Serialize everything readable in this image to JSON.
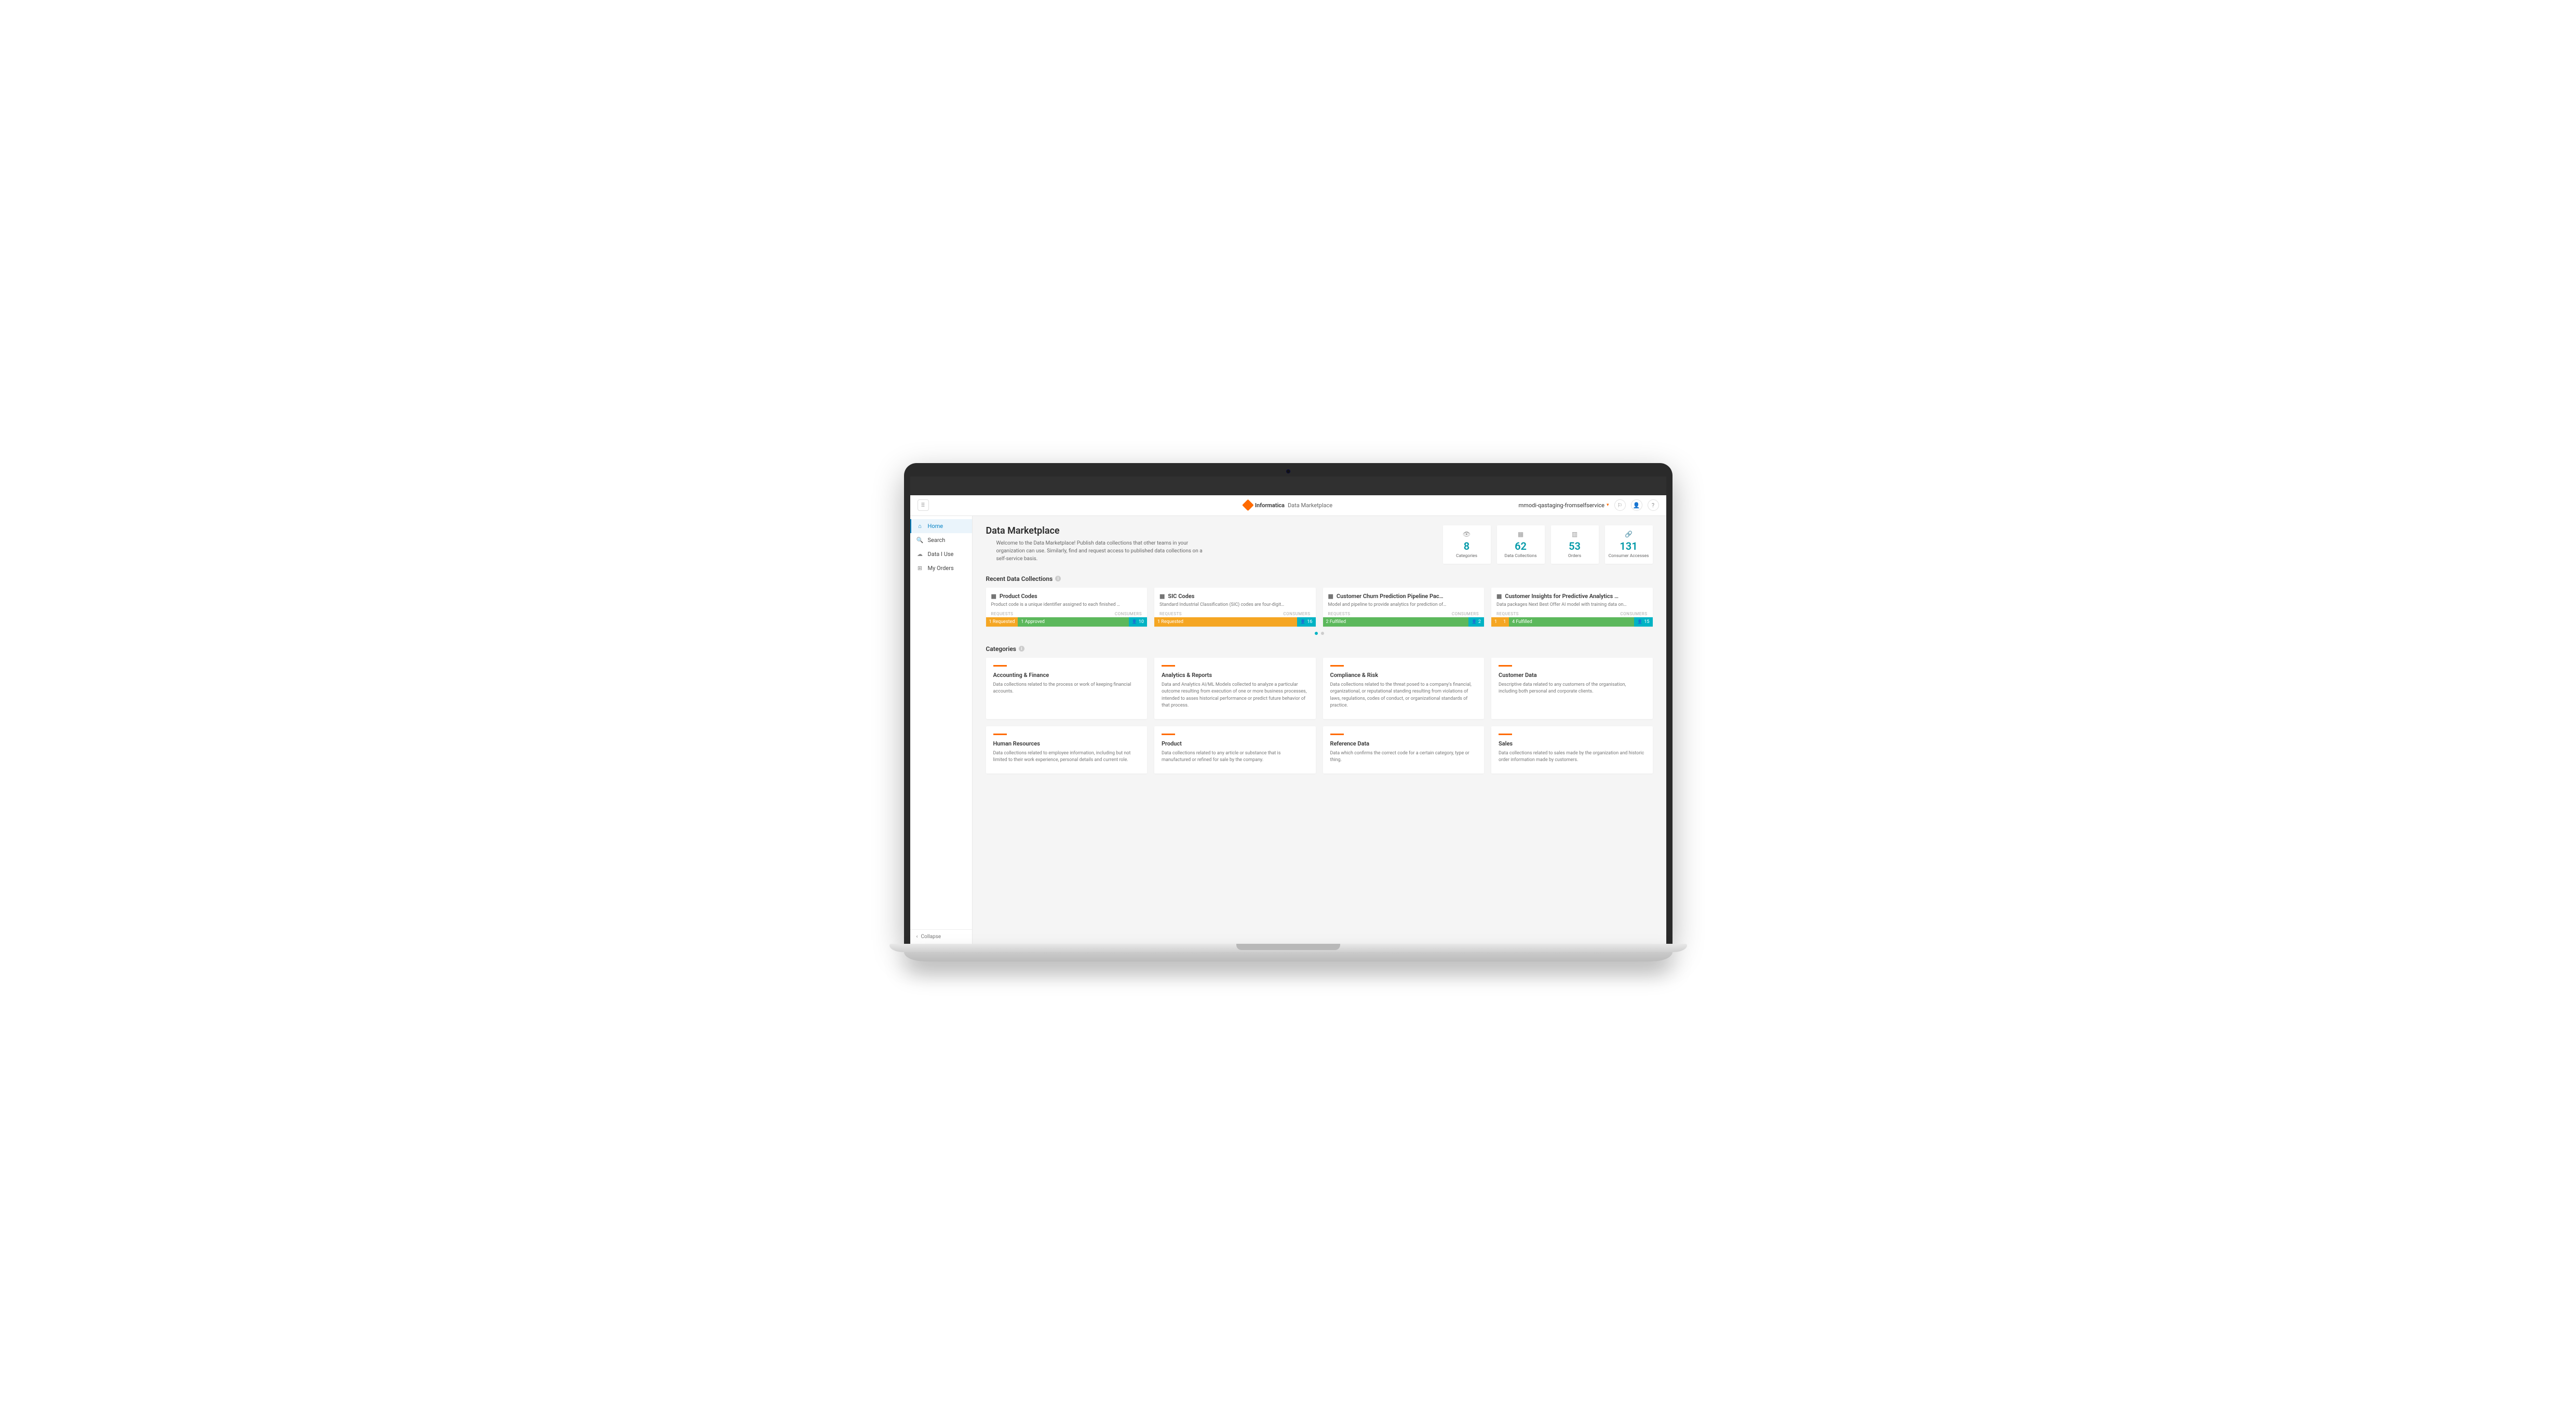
{
  "header": {
    "brand_name": "Informatica",
    "brand_sub": "Data Marketplace",
    "org": "mmodi-qastaging-fromselfservice",
    "icons": {
      "notif": "⚐",
      "user": "👤",
      "help": "?"
    }
  },
  "sidebar": {
    "items": [
      {
        "icon": "⌂",
        "label": "Home"
      },
      {
        "icon": "🔍",
        "label": "Search"
      },
      {
        "icon": "☁",
        "label": "Data I Use"
      },
      {
        "icon": "⊞",
        "label": "My Orders"
      }
    ],
    "collapse": "Collapse"
  },
  "page": {
    "title": "Data Marketplace",
    "desc": "Welcome to the Data Marketplace! Publish data collections that other teams in your organization can use. Similarly, find and request access to published data collections on a self-service basis."
  },
  "stats": [
    {
      "icon": "👁",
      "value": "8",
      "label": "Categories"
    },
    {
      "icon": "▦",
      "value": "62",
      "label": "Data Collections"
    },
    {
      "icon": "▥",
      "value": "53",
      "label": "Orders"
    },
    {
      "icon": "🔗",
      "value": "131",
      "label": "Consumer Accesses"
    }
  ],
  "sections": {
    "recent": "Recent Data Collections",
    "categories": "Categories",
    "requests": "REQUESTS",
    "consumers": "CONSUMERS"
  },
  "recent": [
    {
      "title": "Product Codes",
      "desc": "Product code is a unique identifier assigned to each finished …",
      "segs": [
        {
          "cls": "orange",
          "text": "1 Requested"
        },
        {
          "cls": "green",
          "text": "1 Approved"
        }
      ],
      "consumers": "10"
    },
    {
      "title": "SIC Codes",
      "desc": "Standard Industrial Classification (SIC) codes are four-digit…",
      "segs": [
        {
          "cls": "orange",
          "text": "1 Requested",
          "flex": true
        }
      ],
      "consumers": "16"
    },
    {
      "title": "Customer Churn Prediction Pipeline Pac…",
      "desc": "Model and pipeline to provide analytics for prediction of…",
      "segs": [
        {
          "cls": "green",
          "text": "2 Fulfilled",
          "flex": true
        }
      ],
      "consumers": "2"
    },
    {
      "title": "Customer Insights for Predictive Analytics …",
      "desc": "Data packages Next Best Offer AI model with training data on…",
      "segs": [
        {
          "cls": "orange",
          "text": "1"
        },
        {
          "cls": "orange",
          "text": "1"
        },
        {
          "cls": "green",
          "text": "4 Fulfilled"
        }
      ],
      "consumers": "15"
    }
  ],
  "categories": [
    {
      "title": "Accounting & Finance",
      "desc": "Data collections related to the process or work of keeping financial accounts."
    },
    {
      "title": "Analytics & Reports",
      "desc": "Data and Analytics AI/ML Models collected to analyze a particular outcome resulting from execution of one or more business processes, intended to asses historical performance or predict future behavior of that process."
    },
    {
      "title": "Compliance & Risk",
      "desc": "Data collections related to the threat posed to a company's financial, organizational, or reputational standing resulting from violations of laws, regulations, codes of conduct, or organizational standards of practice."
    },
    {
      "title": "Customer Data",
      "desc": "Descriptive data related to any customers of the organisation, including both personal and corporate clients."
    },
    {
      "title": "Human Resources",
      "desc": "Data collections related to employee information, including but not limited to their work experience, personal details and current role."
    },
    {
      "title": "Product",
      "desc": "Data collections related to any article or substance that is manufactured or refined for sale by the company."
    },
    {
      "title": "Reference Data",
      "desc": "Data which confirms the correct code for a certain category, type or thing."
    },
    {
      "title": "Sales",
      "desc": "Data collections related to sales made by the organization and historic order information made by customers."
    }
  ]
}
